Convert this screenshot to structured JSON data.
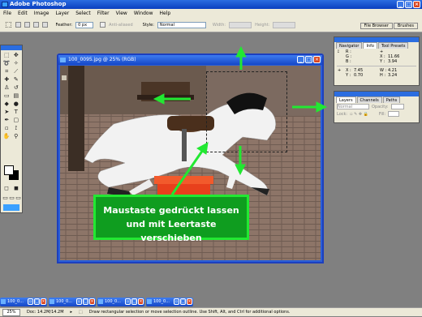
{
  "app": {
    "title": "Adobe Photoshop"
  },
  "menu": [
    "File",
    "Edit",
    "Image",
    "Layer",
    "Select",
    "Filter",
    "View",
    "Window",
    "Help"
  ],
  "options": {
    "feather_label": "Feather:",
    "feather_value": "0 px",
    "antialiased_label": "Anti-aliased",
    "style_label": "Style:",
    "style_value": "Normal",
    "width_label": "Width:",
    "height_label": "Height:"
  },
  "palette_tabs": [
    "File Browser",
    "Brushes"
  ],
  "document": {
    "title": "100_0095.jpg @ 25% (RGB)"
  },
  "info_panel": {
    "tabs": [
      "Navigator",
      "Info",
      "Tool Presets"
    ],
    "row1": {
      "l1": "R :",
      "l2": "G :",
      "l3": "B :",
      "x_label": "X :",
      "x_value": "11.66",
      "y_label": "Y :",
      "y_value": "3.94"
    },
    "row2": {
      "x_label": "X :",
      "x_value": "7.45",
      "y_label": "Y :",
      "y_value": "0.70",
      "w_label": "W :",
      "w_value": "4.21",
      "h_label": "H :",
      "h_value": "3.24"
    }
  },
  "layers_panel": {
    "tabs": [
      "Layers",
      "Channels",
      "Paths"
    ],
    "mode": "Normal",
    "opacity_label": "Opacity:",
    "lock_label": "Lock:",
    "fill_label": "Fill:"
  },
  "minimized": [
    "100_0...",
    "100_0...",
    "100_0...",
    "100_0..."
  ],
  "status": {
    "zoom": "25%",
    "doc": "Doc: 14.2M/14.2M",
    "hint": "Draw rectangular selection or move selection outline. Use Shift, Alt, and Ctrl for additional options."
  },
  "callout": {
    "line1": "Maustaste gedrückt lassen",
    "line2": "und mit Leertaste verschieben"
  },
  "colors": {
    "accent_green": "#22e832",
    "title_blue": "#1547c7"
  }
}
